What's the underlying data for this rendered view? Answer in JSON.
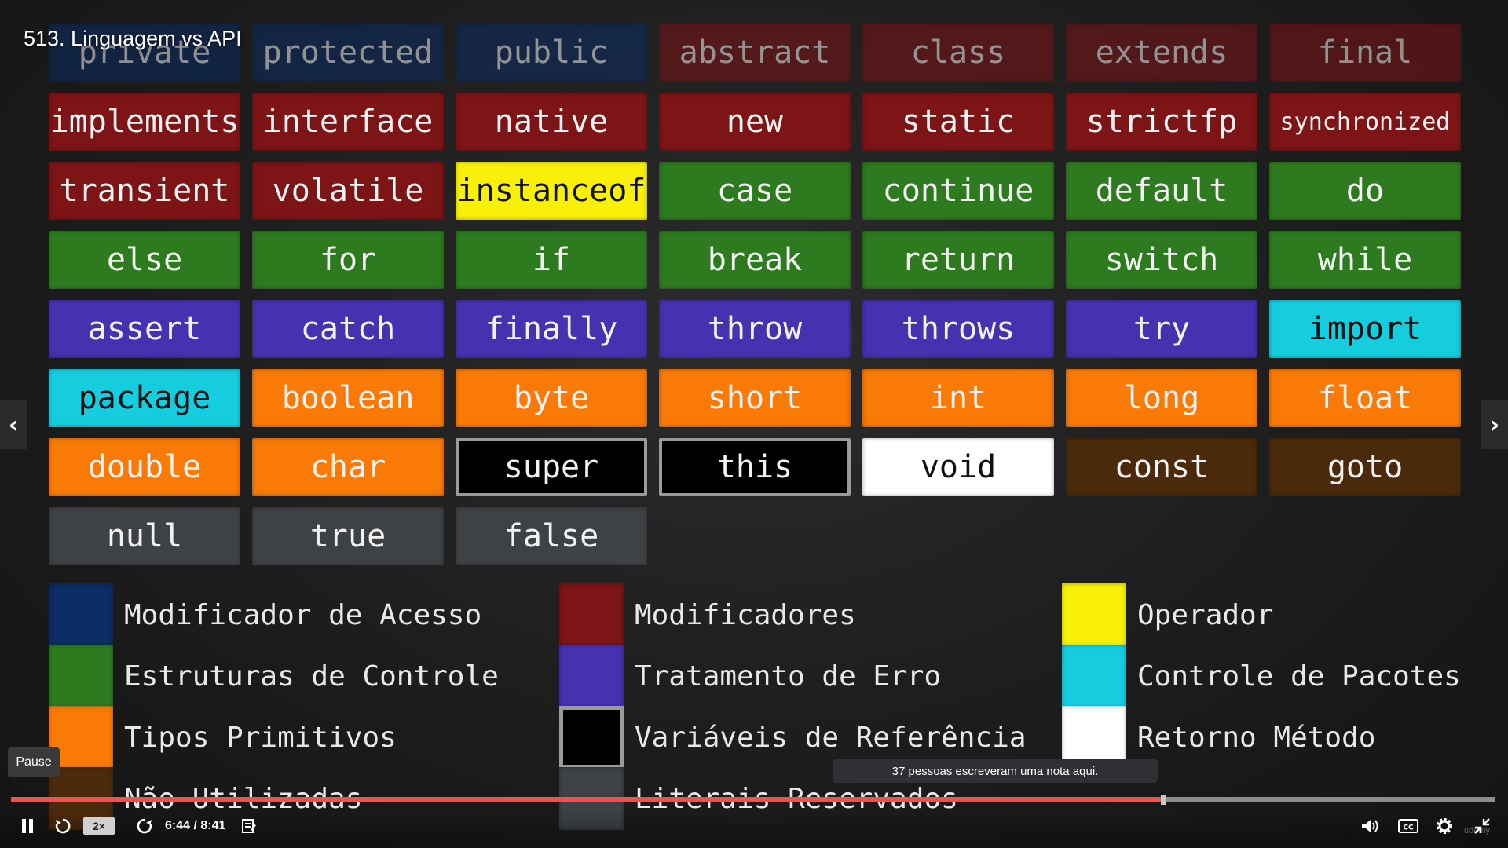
{
  "lecture": {
    "title": "513. Linguagem vs API"
  },
  "colors": {
    "access_modifier": "#0c2d63",
    "modifier": "#7d1416",
    "operator": "#f9f00a",
    "control": "#2e7a1f",
    "error_handling": "#4532b0",
    "package_control": "#16cde0",
    "primitive": "#f97a07",
    "reference": "#000000",
    "method_return": "#ffffff",
    "unused": "#4b2a0c",
    "literal": "#3f4245"
  },
  "keywords": [
    {
      "text": "private",
      "category": "access_modifier",
      "dim": true
    },
    {
      "text": "protected",
      "category": "access_modifier",
      "dim": true
    },
    {
      "text": "public",
      "category": "access_modifier",
      "dim": true
    },
    {
      "text": "abstract",
      "category": "modifier",
      "dim": true
    },
    {
      "text": "class",
      "category": "modifier",
      "dim": true
    },
    {
      "text": "extends",
      "category": "modifier",
      "dim": true
    },
    {
      "text": "final",
      "category": "modifier",
      "dim": true
    },
    {
      "text": "implements",
      "category": "modifier"
    },
    {
      "text": "interface",
      "category": "modifier"
    },
    {
      "text": "native",
      "category": "modifier"
    },
    {
      "text": "new",
      "category": "modifier"
    },
    {
      "text": "static",
      "category": "modifier"
    },
    {
      "text": "strictfp",
      "category": "modifier"
    },
    {
      "text": "synchronized",
      "category": "modifier",
      "small": true
    },
    {
      "text": "transient",
      "category": "modifier"
    },
    {
      "text": "volatile",
      "category": "modifier"
    },
    {
      "text": "instanceof",
      "category": "operator"
    },
    {
      "text": "case",
      "category": "control"
    },
    {
      "text": "continue",
      "category": "control"
    },
    {
      "text": "default",
      "category": "control"
    },
    {
      "text": "do",
      "category": "control"
    },
    {
      "text": "else",
      "category": "control"
    },
    {
      "text": "for",
      "category": "control"
    },
    {
      "text": "if",
      "category": "control"
    },
    {
      "text": "break",
      "category": "control"
    },
    {
      "text": "return",
      "category": "control"
    },
    {
      "text": "switch",
      "category": "control"
    },
    {
      "text": "while",
      "category": "control"
    },
    {
      "text": "assert",
      "category": "error_handling"
    },
    {
      "text": "catch",
      "category": "error_handling"
    },
    {
      "text": "finally",
      "category": "error_handling"
    },
    {
      "text": "throw",
      "category": "error_handling"
    },
    {
      "text": "throws",
      "category": "error_handling"
    },
    {
      "text": "try",
      "category": "error_handling"
    },
    {
      "text": "import",
      "category": "package_control"
    },
    {
      "text": "package",
      "category": "package_control"
    },
    {
      "text": "boolean",
      "category": "primitive"
    },
    {
      "text": "byte",
      "category": "primitive"
    },
    {
      "text": "short",
      "category": "primitive"
    },
    {
      "text": "int",
      "category": "primitive"
    },
    {
      "text": "long",
      "category": "primitive"
    },
    {
      "text": "float",
      "category": "primitive"
    },
    {
      "text": "double",
      "category": "primitive"
    },
    {
      "text": "char",
      "category": "primitive"
    },
    {
      "text": "super",
      "category": "reference"
    },
    {
      "text": "this",
      "category": "reference"
    },
    {
      "text": "void",
      "category": "method_return"
    },
    {
      "text": "const",
      "category": "unused"
    },
    {
      "text": "goto",
      "category": "unused"
    },
    {
      "text": "null",
      "category": "literal"
    },
    {
      "text": "true",
      "category": "literal"
    },
    {
      "text": "false",
      "category": "literal"
    }
  ],
  "legend": [
    {
      "label": "Modificador de Acesso",
      "category": "access_modifier"
    },
    {
      "label": "Estruturas de Controle",
      "category": "control"
    },
    {
      "label": "Tipos Primitivos",
      "category": "primitive"
    },
    {
      "label": "Não Utilizadas",
      "category": "unused"
    },
    {
      "label": "Modificadores",
      "category": "modifier"
    },
    {
      "label": "Tratamento de Erro",
      "category": "error_handling"
    },
    {
      "label": "Variáveis de Referência",
      "category": "reference"
    },
    {
      "label": "Literais Reservados",
      "category": "literal"
    },
    {
      "label": "Operador",
      "category": "operator"
    },
    {
      "label": "Controle de Pacotes",
      "category": "package_control"
    },
    {
      "label": "Retorno Método",
      "category": "method_return"
    }
  ],
  "player": {
    "pause_tooltip": "Pause",
    "note_tooltip": "37 pessoas escreveram uma nota aqui.",
    "speed": "2×",
    "time": "6:44 / 8:41",
    "progress": 0.776,
    "brand": "udemy",
    "accent_color": "#ec5252",
    "icons": [
      "pause-icon",
      "rewind-icon",
      "forward-icon",
      "notes-icon",
      "volume-icon",
      "captions-icon",
      "settings-icon",
      "fullscreen-exit-icon",
      "chevron-left-icon",
      "chevron-right-icon"
    ]
  }
}
